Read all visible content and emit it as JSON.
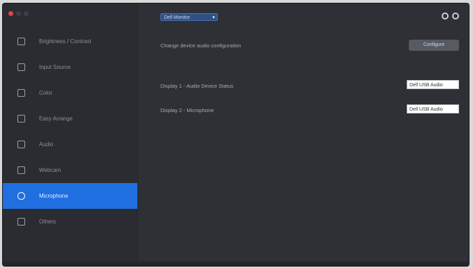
{
  "window": {
    "controls": [
      "close",
      "minimize",
      "maximize"
    ],
    "colors": {
      "close": "#e0443e",
      "minimize": "#3b3e45",
      "maximize": "#3b3e45"
    }
  },
  "sidebar": {
    "items": [
      {
        "label": "Brightness / Contrast",
        "icon": "sun-icon"
      },
      {
        "label": "Input Source",
        "icon": "input-icon"
      },
      {
        "label": "Color",
        "icon": "palette-icon"
      },
      {
        "label": "Easy Arrange",
        "icon": "layout-icon"
      },
      {
        "label": "Audio",
        "icon": "speaker-icon"
      },
      {
        "label": "Webcam",
        "icon": "camera-icon"
      },
      {
        "label": "Microphone",
        "icon": "microphone-icon",
        "active": true
      },
      {
        "label": "Others",
        "icon": "grid-icon"
      }
    ]
  },
  "header": {
    "selector_value": "Dell Monitor",
    "icons": [
      "settings-icon",
      "info-icon"
    ]
  },
  "main": {
    "row1_label": "Change device audio configuration",
    "row1_button": "Configure",
    "row2_label": "Display 1 - Audio Device Status",
    "row2_value": "Dell USB Audio",
    "row3_label": "Display 2 - Microphone",
    "row3_value": "Dell USB Audio"
  },
  "accent_color": "#1f6fe0"
}
